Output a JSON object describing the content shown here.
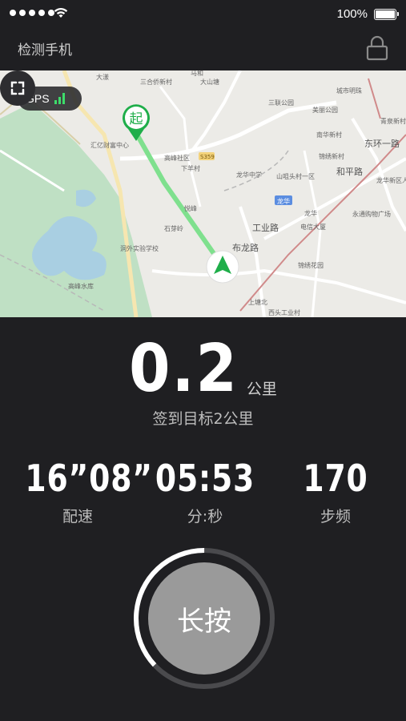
{
  "status_bar": {
    "battery": "100%"
  },
  "header": {
    "title": "检测手机",
    "lock_icon": "lock-icon"
  },
  "map": {
    "gps_label": "GPS",
    "start_marker": "起",
    "expand_icon": "expand-icon",
    "labels": {
      "dayang": "大漾",
      "sanhe": "三合侨新村",
      "mahe": "马和",
      "dashan": "大山塘",
      "sanlian": "三联公园",
      "huiyi": "汇亿财富中心",
      "gaofeng": "高峰社区",
      "xiawu": "下羊村",
      "longhua_middle": "龙华中学",
      "shanmi": "山咀头村一区",
      "longhua": "龙华",
      "longhua_badge": "龙华",
      "gaofeng_reservoir": "高峰水库",
      "gongye": "工业路",
      "hexinlu": "和平路",
      "huanlu": "布龙路",
      "dongfu": "东环一路",
      "chaoji": "锦绣新村",
      "qingquan": "青泉新村",
      "yuefeng": "悦峰",
      "shangtang": "上塘北",
      "renmin": "龙华新区人民医院",
      "chengshi": "城市明珠",
      "nanhua": "南华新村",
      "dianxin": "电信大厦",
      "yongtong": "永通购物广场",
      "jinxiu": "锦绣花园",
      "xitou": "西头工业村",
      "yunxi": "洞外实验学校",
      "shixin": "石芽岭",
      "sbad": "S359",
      "meilong": "美丽公园"
    }
  },
  "distance": {
    "value": "0.2",
    "unit": "公里",
    "target": "签到目标2公里"
  },
  "stats": [
    {
      "value": "16”08”",
      "label": "配速"
    },
    {
      "value": "05:53",
      "label": "分:秒"
    },
    {
      "value": "170",
      "label": "步频"
    }
  ],
  "press_button": {
    "label": "长按",
    "progress": 0.37
  },
  "colors": {
    "background": "#1f1f22",
    "route": "#7fe08e",
    "marker": "#1fae4a",
    "button": "#9a9a9a"
  }
}
